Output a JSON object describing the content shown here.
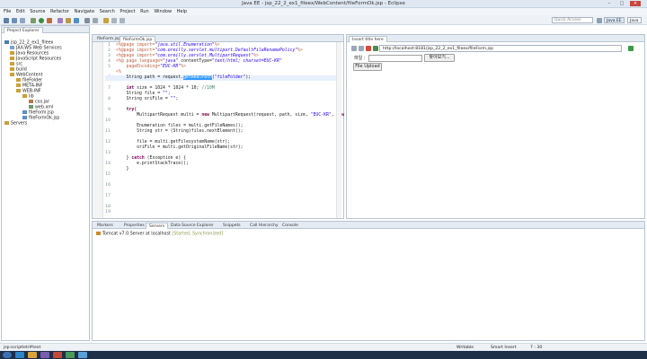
{
  "window": {
    "title": "Java EE - jsp_22_2_ex1_fileex/WebContent/fileFormOk.jsp - Eclipse",
    "controls": [
      "–",
      "□",
      "✕"
    ]
  },
  "menu": [
    "File",
    "Edit",
    "Source",
    "Refactor",
    "Navigate",
    "Search",
    "Project",
    "Run",
    "Window",
    "Help"
  ],
  "toolbar": {
    "quick_access_placeholder": "Quick Access",
    "perspectives": [
      "Java EE",
      "Java"
    ]
  },
  "explorer": {
    "tab_label": "Project Explorer",
    "items": [
      "jsp_22_2_ex1_fileex",
      "JAX-WS Web Services",
      "Java Resources",
      "JavaScript Resources",
      "src",
      "build",
      "WebContent",
      "fileFolder",
      "META-INF",
      "WEB-INF",
      "lib",
      "cos.jar",
      "web.xml",
      "fileForm.jsp",
      "fileFormOk.jsp",
      "Servers"
    ]
  },
  "editor": {
    "tabs": [
      "fileForm.jsp",
      "fileFormOk.jsp"
    ],
    "line_numbers": [
      "1",
      "2",
      "3",
      "4",
      "5",
      "",
      "6",
      "7",
      "8",
      "9",
      "10",
      "11",
      "12",
      "13",
      "14",
      "15",
      "16",
      "17",
      "18",
      "19",
      "20",
      "21",
      "22",
      "23"
    ],
    "lines": {
      "l1a": "<%@page import=",
      "l1b": "\"java.util.Enumeration\"",
      "l1c": "%>",
      "l2a": "<%@page import=",
      "l2b": "\"com.oreilly.servlet.multipart.DefaultFileRenamePolicy\"",
      "l2c": "%>",
      "l3a": "<%@page import=",
      "l3b": "\"com.oreilly.servlet.MultipartRequest\"",
      "l3c": "%>",
      "l4a": "<%@ page language=",
      "l4b": "\"java\"",
      "l4c": " contentType=",
      "l4d": "\"text/html; charset=EUC-KR\"",
      "l5a": "    pageEncoding=",
      "l5b": "\"EUC-KR\"",
      "l5c": "%>",
      "l6": "<%",
      "l7a": "    String path = request.",
      "l7b": "getRealPath",
      "l7c": "(",
      "l7d": "\"fileFolder\"",
      "l7e": ");",
      "l9a": "    ",
      "l9b": "int",
      "l9c": " size = 1024 * 1024 * 10; ",
      "l9d": "//10M",
      "l10a": "    String file = ",
      "l10b": "\"\"",
      "l10c": ";",
      "l11a": "    String oriFile = ",
      "l11b": "\"\"",
      "l11c": ";",
      "l13a": "    ",
      "l13b": "try",
      "l13c": "{",
      "l14a": "        MultipartRequest multi = ",
      "l14b": "new",
      "l14c": " MultipartRequest(request, path, size, ",
      "l14d": "\"EUC-KR\"",
      "l14e": ", ",
      "l14f": "new",
      "l16": "        Enumeration files = multi.getFileNames();",
      "l17": "        String str = (String)files.nextElement();",
      "l19": "        file = multi.getFilesystemName(str);",
      "l20": "        oriFile = multi.getOriginalFileName(str);",
      "l22a": "    } ",
      "l22b": "catch",
      "l22c": " (Exception e) {",
      "l23": "        e.printStackTrace();",
      "l24": "    }"
    }
  },
  "browser": {
    "tab_label": "Insert title here",
    "url": "http://localhost:8181/jsp_22_2_ex1_fileex/fileForm.jsp",
    "file_label": "파일 :",
    "browse_button": "찾아보기...",
    "upload_button": "File Upload"
  },
  "bottom": {
    "tabs": [
      "Markers",
      "Properties",
      "Servers",
      "Data Source Explorer",
      "Snippets",
      "Call Hierarchy",
      "Console"
    ],
    "server_name": "Tomcat v7.0 Server at localhost",
    "server_state": "[Started, Synchronized]"
  },
  "status": {
    "path": "jsp:scriptlet/#text",
    "writable": "Writable",
    "insert_mode": "Smart Insert",
    "position": "7 : 30"
  },
  "colors": {
    "keyword": "#7f0055",
    "string": "#2a00ff",
    "comment": "#3f7f5f",
    "jsp_tag": "#bf5f3f",
    "selection": "#3399ff"
  }
}
